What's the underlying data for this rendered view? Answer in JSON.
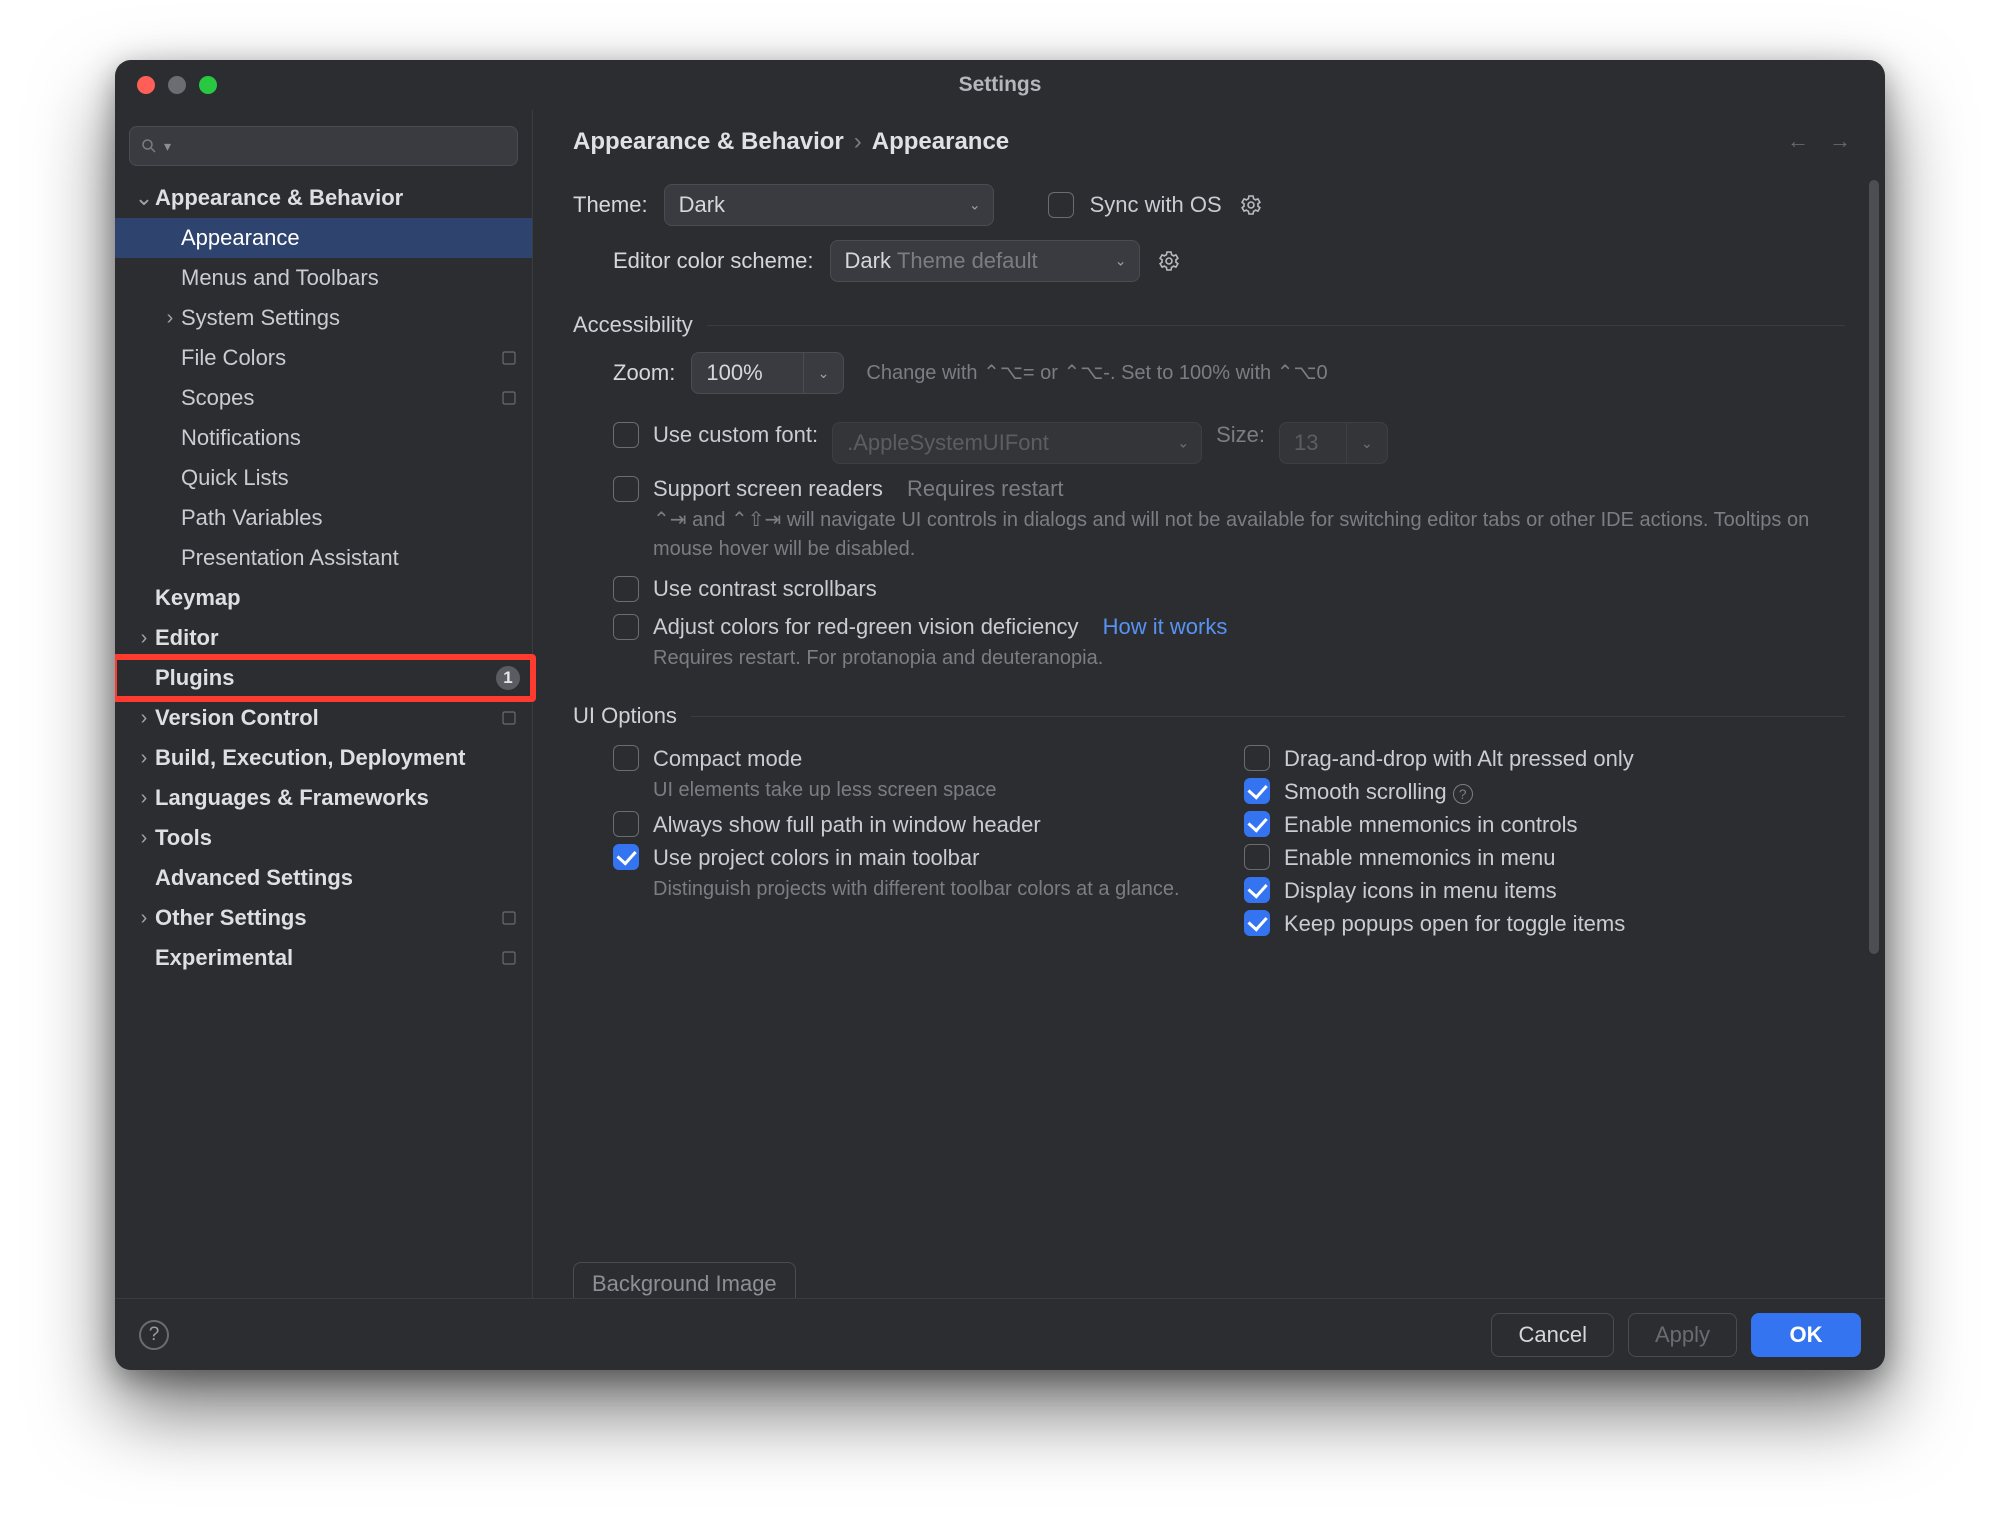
{
  "window": {
    "title": "Settings"
  },
  "search": {
    "placeholder": ""
  },
  "breadcrumb": {
    "a": "Appearance & Behavior",
    "b": "Appearance"
  },
  "sidebar": {
    "items": [
      {
        "label": "Appearance & Behavior",
        "bold": true,
        "arrow": "down",
        "depth": 0
      },
      {
        "label": "Appearance",
        "depth": 1,
        "selected": true
      },
      {
        "label": "Menus and Toolbars",
        "depth": 1
      },
      {
        "label": "System Settings",
        "depth": 1,
        "arrow": "right"
      },
      {
        "label": "File Colors",
        "depth": 1,
        "tag": true
      },
      {
        "label": "Scopes",
        "depth": 1,
        "tag": true
      },
      {
        "label": "Notifications",
        "depth": 1
      },
      {
        "label": "Quick Lists",
        "depth": 1
      },
      {
        "label": "Path Variables",
        "depth": 1
      },
      {
        "label": "Presentation Assistant",
        "depth": 1
      },
      {
        "label": "Keymap",
        "bold": true,
        "depth": 0
      },
      {
        "label": "Editor",
        "bold": true,
        "depth": 0,
        "arrow": "right"
      },
      {
        "label": "Plugins",
        "bold": true,
        "depth": 0,
        "badge": "1",
        "highlight": true
      },
      {
        "label": "Version Control",
        "bold": true,
        "depth": 0,
        "arrow": "right",
        "tag": true
      },
      {
        "label": "Build, Execution, Deployment",
        "bold": true,
        "depth": 0,
        "arrow": "right"
      },
      {
        "label": "Languages & Frameworks",
        "bold": true,
        "depth": 0,
        "arrow": "right"
      },
      {
        "label": "Tools",
        "bold": true,
        "depth": 0,
        "arrow": "right"
      },
      {
        "label": "Advanced Settings",
        "bold": true,
        "depth": 0
      },
      {
        "label": "Other Settings",
        "bold": true,
        "depth": 0,
        "arrow": "right",
        "tag": true
      },
      {
        "label": "Experimental",
        "bold": true,
        "depth": 0,
        "tag": true
      }
    ]
  },
  "theme": {
    "label": "Theme:",
    "value": "Dark",
    "sync_label": "Sync with OS"
  },
  "editor_scheme": {
    "label": "Editor color scheme:",
    "value": "Dark",
    "hint": "Theme default"
  },
  "sections": {
    "accessibility": "Accessibility",
    "ui_options": "UI Options"
  },
  "zoom": {
    "label": "Zoom:",
    "value": "100%",
    "hint": "Change with ⌃⌥= or ⌃⌥-. Set to 100% with ⌃⌥0"
  },
  "custom_font": {
    "label": "Use custom font:",
    "value": ".AppleSystemUIFont",
    "size_label": "Size:",
    "size_value": "13"
  },
  "screen_readers": {
    "label": "Support screen readers",
    "requires": "Requires restart",
    "detail": "⌃⇥ and ⌃⇧⇥ will navigate UI controls in dialogs and will not be available for switching editor tabs or other IDE actions. Tooltips on mouse hover will be disabled."
  },
  "contrast_scrollbars": {
    "label": "Use contrast scrollbars"
  },
  "color_deficiency": {
    "label": "Adjust colors for red-green vision deficiency",
    "link": "How it works",
    "detail": "Requires restart. For protanopia and deuteranopia."
  },
  "ui_left": [
    {
      "key": "compact",
      "label": "Compact mode",
      "detail": "UI elements take up less screen space",
      "checked": false
    },
    {
      "key": "fullpath",
      "label": "Always show full path in window header",
      "checked": false
    },
    {
      "key": "projcolors",
      "label": "Use project colors in main toolbar",
      "detail": "Distinguish projects with different toolbar colors at a glance.",
      "checked": true
    }
  ],
  "ui_right": [
    {
      "key": "altdrag",
      "label": "Drag-and-drop with Alt pressed only",
      "checked": false
    },
    {
      "key": "smooth",
      "label": "Smooth scrolling",
      "checked": true,
      "info": true
    },
    {
      "key": "mnemctrl",
      "label": "Enable mnemonics in controls",
      "checked": true
    },
    {
      "key": "mnemmenu",
      "label": "Enable mnemonics in menu",
      "checked": false
    },
    {
      "key": "icons",
      "label": "Display icons in menu items",
      "checked": true
    },
    {
      "key": "popups",
      "label": "Keep popups open for toggle items",
      "checked": true
    }
  ],
  "bg_image_button": "Background Image",
  "footer": {
    "cancel": "Cancel",
    "apply": "Apply",
    "ok": "OK"
  }
}
